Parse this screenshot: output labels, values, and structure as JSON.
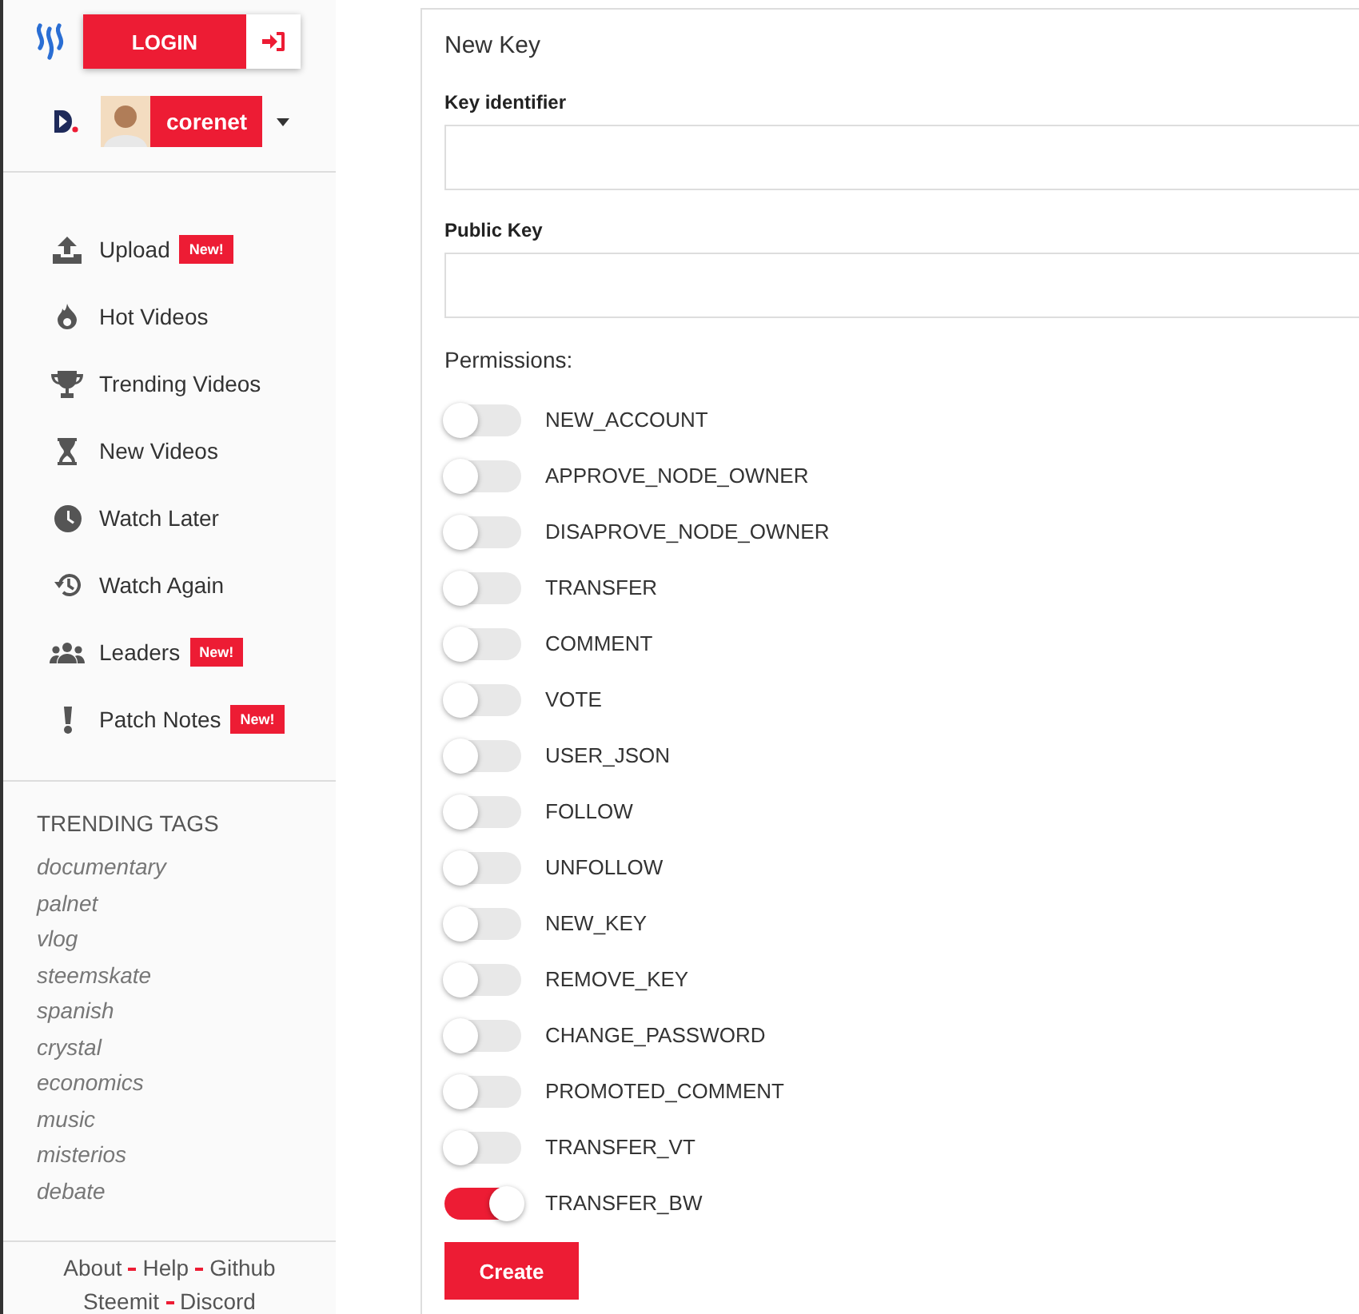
{
  "sidebar": {
    "login_button": "LOGIN",
    "user": {
      "name": "corenet"
    },
    "menu": [
      {
        "label": "Upload",
        "kind": "upload",
        "badge": "New!"
      },
      {
        "label": "Hot Videos",
        "kind": "hot"
      },
      {
        "label": "Trending Videos",
        "kind": "trending"
      },
      {
        "label": "New Videos",
        "kind": "new"
      },
      {
        "label": "Watch Later",
        "kind": "later"
      },
      {
        "label": "Watch Again",
        "kind": "again"
      },
      {
        "label": "Leaders",
        "kind": "leaders",
        "badge": "New!"
      },
      {
        "label": "Patch Notes",
        "kind": "notes",
        "badge": "New!"
      }
    ],
    "trending_tags": {
      "title": "TRENDING TAGS",
      "tags": [
        "documentary",
        "palnet",
        "vlog",
        "steemskate",
        "spanish",
        "crystal",
        "economics",
        "music",
        "misterios",
        "debate"
      ]
    },
    "footer": [
      [
        "About",
        "Help",
        "Github"
      ],
      [
        "Steemit",
        "Discord"
      ]
    ]
  },
  "form": {
    "title": "New Key",
    "fields": [
      {
        "label": "Key identifier"
      },
      {
        "label": "Public Key"
      }
    ],
    "permissions_label": "Permissions:",
    "permissions": [
      {
        "name": "NEW_ACCOUNT",
        "on": false
      },
      {
        "name": "APPROVE_NODE_OWNER",
        "on": false
      },
      {
        "name": "DISAPROVE_NODE_OWNER",
        "on": false
      },
      {
        "name": "TRANSFER",
        "on": false
      },
      {
        "name": "COMMENT",
        "on": false
      },
      {
        "name": "VOTE",
        "on": false
      },
      {
        "name": "USER_JSON",
        "on": false
      },
      {
        "name": "FOLLOW",
        "on": false
      },
      {
        "name": "UNFOLLOW",
        "on": false
      },
      {
        "name": "NEW_KEY",
        "on": false
      },
      {
        "name": "REMOVE_KEY",
        "on": false
      },
      {
        "name": "CHANGE_PASSWORD",
        "on": false
      },
      {
        "name": "PROMOTED_COMMENT",
        "on": false
      },
      {
        "name": "TRANSFER_VT",
        "on": false
      },
      {
        "name": "TRANSFER_BW",
        "on": true
      }
    ],
    "submit": "Create"
  }
}
